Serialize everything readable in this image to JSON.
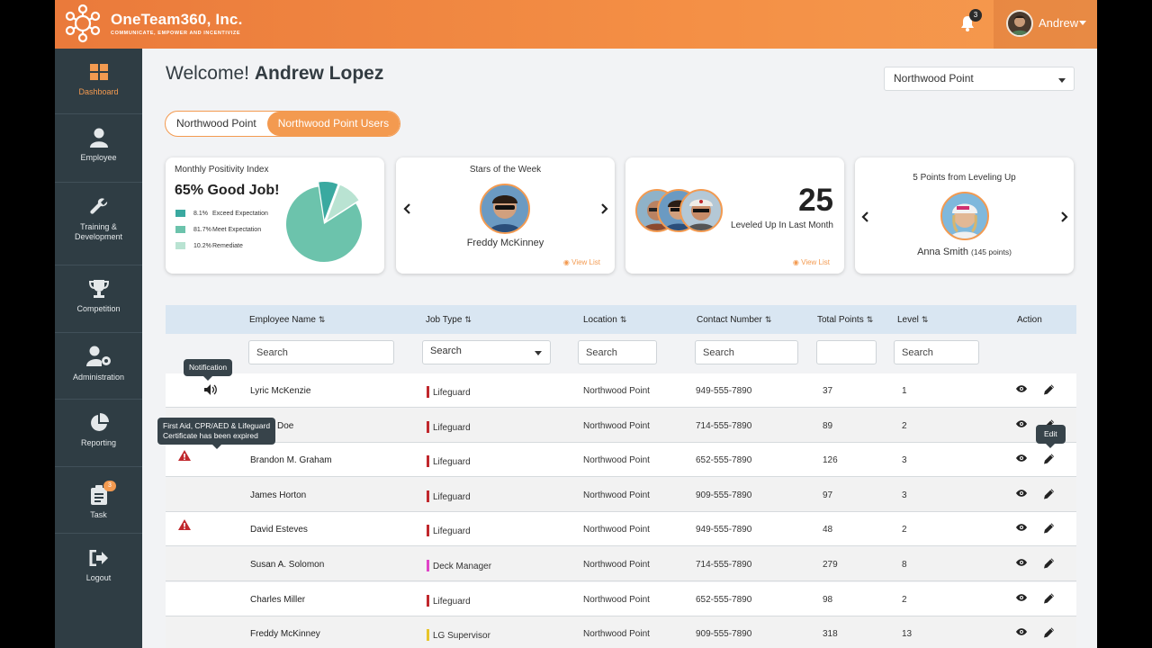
{
  "header": {
    "brand_name": "OneTeam360, Inc.",
    "brand_tagline": "COMMUNICATE, EMPOWER AND INCENTIVIZE",
    "notification_count": "3",
    "user_name": "Andrew"
  },
  "sidebar": {
    "items": [
      {
        "label": "Dashboard",
        "icon": "dashboard-icon"
      },
      {
        "label": "Employee",
        "icon": "user-icon"
      },
      {
        "label": "Training & Development",
        "icon": "wrench-icon"
      },
      {
        "label": "Competition",
        "icon": "trophy-icon"
      },
      {
        "label": "Administration",
        "icon": "user-gear-icon"
      },
      {
        "label": "Reporting",
        "icon": "pie-chart-icon"
      },
      {
        "label": "Task",
        "icon": "clipboard-icon",
        "badge": "3"
      },
      {
        "label": "Logout",
        "icon": "logout-icon"
      }
    ]
  },
  "main": {
    "welcome_prefix": "Welcome!",
    "welcome_name": "Andrew Lopez",
    "location_select": "Northwood Point",
    "toggle": [
      "Northwood Point",
      "Northwood Point Users"
    ]
  },
  "cards": {
    "positivity": {
      "title": "Monthly Positivity Index",
      "headline": "65% Good Job!",
      "legend": [
        {
          "pct": "8.1%",
          "label": "Exceed Expectation",
          "color": "#3aa9a0",
          "value": 8.1
        },
        {
          "pct": "81.7%",
          "label": "Meet Expectation",
          "color": "#6cc3ac",
          "value": 81.7
        },
        {
          "pct": "10.2%",
          "label": "Remediate",
          "color": "#b9e3d2",
          "value": 10.2
        }
      ]
    },
    "stars": {
      "title": "Stars of the Week",
      "name": "Freddy McKinney",
      "link": "View List"
    },
    "leveled": {
      "count": "25",
      "caption": "Leveled Up In Last Month",
      "link": "View List"
    },
    "points": {
      "title": "5 Points from Leveling Up",
      "name": "Anna Smith",
      "sub": "(145 points)"
    }
  },
  "table": {
    "columns": [
      "Employee Name",
      "Job Type",
      "Location",
      "Contact Number",
      "Total Points",
      "Level",
      "Action"
    ],
    "filters": {
      "placeholder": "Search"
    },
    "rows": [
      {
        "name": "Lyric McKenzie",
        "job": "Lifeguard",
        "job_color": "#c0282d",
        "location": "Northwood Point",
        "contact": "949-555-7890",
        "points": "37",
        "level": "1"
      },
      {
        "name": "Doe",
        "job": "Lifeguard",
        "job_color": "#c0282d",
        "location": "Northwood Point",
        "contact": "714-555-7890",
        "points": "89",
        "level": "2"
      },
      {
        "name": "Brandon M. Graham",
        "job": "Lifeguard",
        "job_color": "#c0282d",
        "location": "Northwood Point",
        "contact": "652-555-7890",
        "points": "126",
        "level": "3"
      },
      {
        "name": "James Horton",
        "job": "Lifeguard",
        "job_color": "#c0282d",
        "location": "Northwood Point",
        "contact": "909-555-7890",
        "points": "97",
        "level": "3"
      },
      {
        "name": "David Esteves",
        "job": "Lifeguard",
        "job_color": "#c0282d",
        "location": "Northwood Point",
        "contact": "949-555-7890",
        "points": "48",
        "level": "2"
      },
      {
        "name": "Susan A. Solomon",
        "job": "Deck Manager",
        "job_color": "#e044c8",
        "location": "Northwood Point",
        "contact": "714-555-7890",
        "points": "279",
        "level": "8"
      },
      {
        "name": "Charles Miller",
        "job": "Lifeguard",
        "job_color": "#c0282d",
        "location": "Northwood Point",
        "contact": "652-555-7890",
        "points": "98",
        "level": "2"
      },
      {
        "name": "Freddy McKinney",
        "job": "LG Supervisor",
        "job_color": "#e8c52a",
        "location": "Northwood Point",
        "contact": "909-555-7890",
        "points": "318",
        "level": "13"
      }
    ]
  },
  "tooltips": {
    "notification": "Notification",
    "expired_line1": "First Aid, CPR/AED & Lifeguard",
    "expired_line2": "Certificate has been expired",
    "edit": "Edit"
  }
}
